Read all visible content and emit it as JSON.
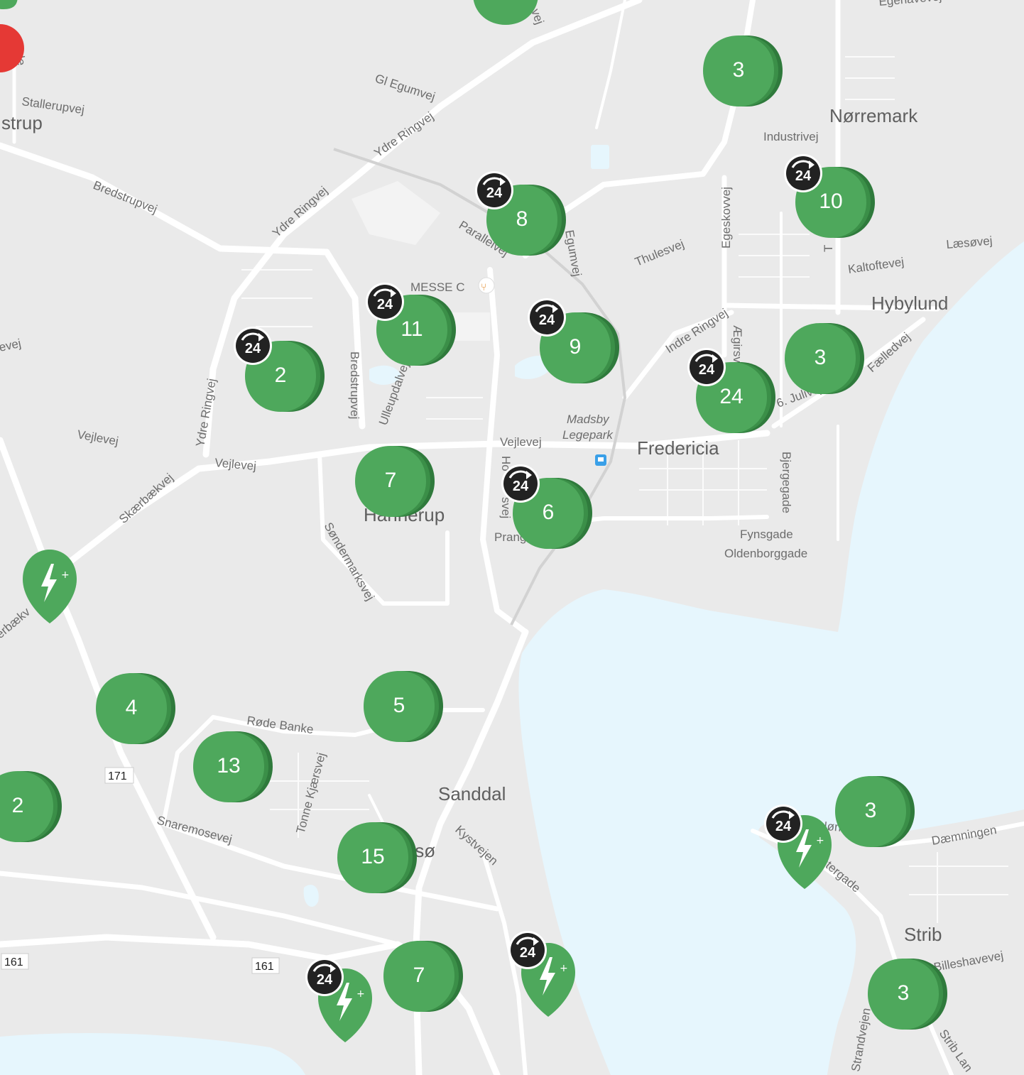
{
  "places": {
    "fredericia": "Fredericia",
    "norremark": "Nørremark",
    "hybylund": "Hybylund",
    "hannerup": "Hannerup",
    "sanddal": "Sanddal",
    "strib": "Strib",
    "strup": "strup",
    "madsby1": "Madsby",
    "madsby2": "Legepark",
    "messe": "MESSE C",
    "tso": "tsø"
  },
  "roads": {
    "gl_egumvej": "Gl Egumvej",
    "ydre_ringvej_1": "Ydre Ringvej",
    "ydre_ringvej_2": "Ydre Ringvej",
    "ydre_ringvej_3": "Ydre Ringvej",
    "stallerupvej": "Stallerupvej",
    "bredstrupvej_1": "Bredstrupvej",
    "bredstrupvej_2": "Bredstrupvej",
    "parallelvej": "Parallelvej",
    "egumvej": "Egumvej",
    "egeskovvej": "Egeskovvej",
    "industrivej": "Industrivej",
    "thulesvej": "Thulesvej",
    "kaltoftevej": "Kaltoftevej",
    "laesovej": "Læsøvej",
    "indre_ringvej": "Indre Ringvej",
    "aegirsvej": "Ægirsv",
    "faelledvej": "Fælledvej",
    "juli": "6. Julivej",
    "ulleupdalvej": "Ulleupdalvej",
    "vejlevej_1": "Vejlevej",
    "vejlevej_2": "Vejlevej",
    "vejlevej_3": "Vejlevej",
    "evej": "evej",
    "skaerbaekvej": "Skærbækvej",
    "skaerbaekvej_2": "erbækv",
    "sondermarksvej": "Søndermarksvej",
    "hovej": "Ho",
    "hovej_2": "svej",
    "prang": "Prang",
    "bjergegade": "Bjergegade",
    "fynsgade": "Fynsgade",
    "oldenborggade": "Oldenborggade",
    "rode_banke": "Røde Banke",
    "tonne_kjaersvej": "Tonne Kjærsvej",
    "snaremosevej": "Snaremosevej",
    "kystvejen": "Kystvejen",
    "daemningen": "Dæmningen",
    "norre": "Nørre",
    "stergade": "stergade",
    "billeshavevej": "Billeshavevej",
    "strandvejen": "Strandvejen",
    "strib_lan": "Strib Lan",
    "egehavevej": "Egehavevej",
    "vej_top": "vej",
    "ade": "ade",
    "t": "T"
  },
  "route_shields": [
    "171",
    "161",
    "161"
  ],
  "clusters": [
    {
      "name": "cluster-3-north",
      "count": "3",
      "badge": false
    },
    {
      "name": "cluster-10-norremark",
      "count": "10",
      "badge": true
    },
    {
      "name": "cluster-8-parallelvej",
      "count": "8",
      "badge": true
    },
    {
      "name": "cluster-11-messe",
      "count": "11",
      "badge": true
    },
    {
      "name": "cluster-9-madsby",
      "count": "9",
      "badge": true
    },
    {
      "name": "cluster-2-ydre-ringvej",
      "count": "2",
      "badge": true
    },
    {
      "name": "cluster-24-fredericia",
      "count": "24",
      "badge": true
    },
    {
      "name": "cluster-3-hybylund",
      "count": "3",
      "badge": false
    },
    {
      "name": "cluster-7-hannerup",
      "count": "7",
      "badge": false
    },
    {
      "name": "cluster-6-prangervej",
      "count": "6",
      "badge": true
    },
    {
      "name": "cluster-4-west",
      "count": "4",
      "badge": false
    },
    {
      "name": "cluster-5-rode-banke",
      "count": "5",
      "badge": false
    },
    {
      "name": "cluster-13-snaremose",
      "count": "13",
      "badge": false
    },
    {
      "name": "cluster-2-west-edge",
      "count": "2",
      "badge": false
    },
    {
      "name": "cluster-15-erritso",
      "count": "15",
      "badge": false
    },
    {
      "name": "cluster-7-south",
      "count": "7",
      "badge": false
    },
    {
      "name": "cluster-3-strib-north",
      "count": "3",
      "badge": false
    },
    {
      "name": "cluster-3-strib-south",
      "count": "3",
      "badge": false
    }
  ],
  "badge_label": "24",
  "colors": {
    "land": "#eaeaea",
    "water": "#e6f6fd",
    "road": "#ffffff",
    "pin": "#4ea85c",
    "pin_shadow": "#2f7a3c",
    "badge": "#222222",
    "alert": "#e53935"
  },
  "icons": {
    "charging": "charging-station-icon",
    "open24": "open-24-hours-icon",
    "restaurant": "restaurant-icon",
    "bus": "bus-stop-icon"
  }
}
